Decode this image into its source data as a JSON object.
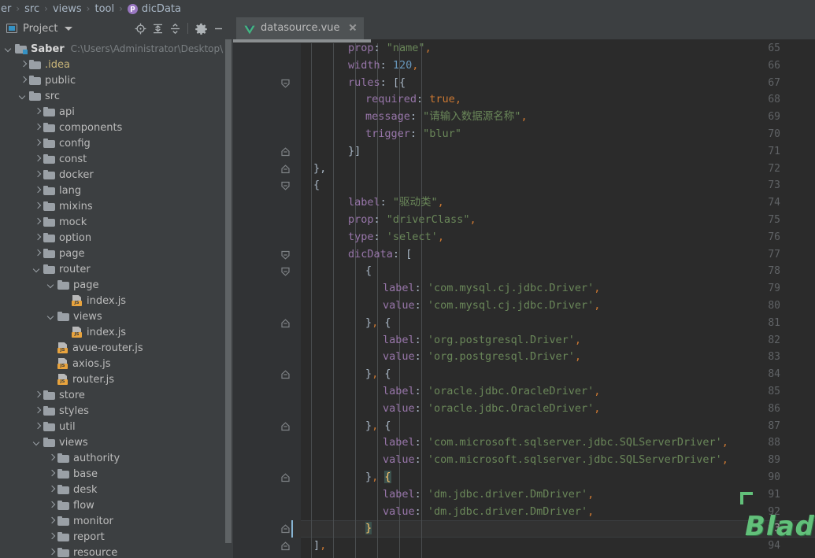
{
  "breadcrumb": {
    "items": [
      {
        "label": "er",
        "icon": null
      },
      {
        "label": "src",
        "icon": null
      },
      {
        "label": "views",
        "icon": null
      },
      {
        "label": "tool",
        "icon": null
      },
      {
        "label": "dicData",
        "icon": "property-icon"
      }
    ],
    "separator": "›",
    "property_icon_glyph": "p"
  },
  "sidebar": {
    "title": "Project",
    "icons": {
      "project": "project-panel-icon",
      "dropdown": "chevron-down-icon",
      "locate": "locate-icon",
      "expand_all": "expand-all-icon",
      "collapse_all": "collapse-all-icon",
      "settings": "gear-icon",
      "hide": "minimize-icon"
    },
    "tree": [
      {
        "label": "Saber",
        "hint": "C:\\Users\\Administrator\\Desktop\\IdeaP",
        "depth": 0,
        "type": "module",
        "state": "expanded",
        "bold": true
      },
      {
        "label": ".idea",
        "depth": 1,
        "type": "folder",
        "state": "collapsed",
        "tint": "yellow"
      },
      {
        "label": "public",
        "depth": 1,
        "type": "folder",
        "state": "collapsed"
      },
      {
        "label": "src",
        "depth": 1,
        "type": "folder",
        "state": "expanded"
      },
      {
        "label": "api",
        "depth": 2,
        "type": "folder",
        "state": "collapsed"
      },
      {
        "label": "components",
        "depth": 2,
        "type": "folder",
        "state": "collapsed"
      },
      {
        "label": "config",
        "depth": 2,
        "type": "folder",
        "state": "collapsed"
      },
      {
        "label": "const",
        "depth": 2,
        "type": "folder",
        "state": "collapsed"
      },
      {
        "label": "docker",
        "depth": 2,
        "type": "folder",
        "state": "collapsed"
      },
      {
        "label": "lang",
        "depth": 2,
        "type": "folder",
        "state": "collapsed"
      },
      {
        "label": "mixins",
        "depth": 2,
        "type": "folder",
        "state": "collapsed"
      },
      {
        "label": "mock",
        "depth": 2,
        "type": "folder",
        "state": "collapsed"
      },
      {
        "label": "option",
        "depth": 2,
        "type": "folder",
        "state": "collapsed"
      },
      {
        "label": "page",
        "depth": 2,
        "type": "folder",
        "state": "collapsed"
      },
      {
        "label": "router",
        "depth": 2,
        "type": "folder",
        "state": "expanded"
      },
      {
        "label": "page",
        "depth": 3,
        "type": "folder",
        "state": "expanded"
      },
      {
        "label": "index.js",
        "depth": 4,
        "type": "js"
      },
      {
        "label": "views",
        "depth": 3,
        "type": "folder",
        "state": "expanded"
      },
      {
        "label": "index.js",
        "depth": 4,
        "type": "js"
      },
      {
        "label": "avue-router.js",
        "depth": 3,
        "type": "js"
      },
      {
        "label": "axios.js",
        "depth": 3,
        "type": "js"
      },
      {
        "label": "router.js",
        "depth": 3,
        "type": "js"
      },
      {
        "label": "store",
        "depth": 2,
        "type": "folder",
        "state": "collapsed"
      },
      {
        "label": "styles",
        "depth": 2,
        "type": "folder",
        "state": "collapsed"
      },
      {
        "label": "util",
        "depth": 2,
        "type": "folder",
        "state": "collapsed"
      },
      {
        "label": "views",
        "depth": 2,
        "type": "folder",
        "state": "expanded"
      },
      {
        "label": "authority",
        "depth": 3,
        "type": "folder",
        "state": "collapsed"
      },
      {
        "label": "base",
        "depth": 3,
        "type": "folder",
        "state": "collapsed"
      },
      {
        "label": "desk",
        "depth": 3,
        "type": "folder",
        "state": "collapsed"
      },
      {
        "label": "flow",
        "depth": 3,
        "type": "folder",
        "state": "collapsed"
      },
      {
        "label": "monitor",
        "depth": 3,
        "type": "folder",
        "state": "collapsed"
      },
      {
        "label": "report",
        "depth": 3,
        "type": "folder",
        "state": "collapsed"
      },
      {
        "label": "resource",
        "depth": 3,
        "type": "folder",
        "state": "collapsed"
      }
    ]
  },
  "editor": {
    "tab": {
      "label": "datasource.vue",
      "icon": "vue-icon",
      "close_icon": "close-icon"
    },
    "current_line": 93,
    "first_line": 65,
    "lines": [
      {
        "n": 65,
        "indent": 0,
        "tokens": [
          {
            "t": "prop",
            "c": "prop"
          },
          {
            "t": ": ",
            "c": "pun"
          },
          {
            "t": "\"name\"",
            "c": "str"
          },
          {
            "t": ",",
            "c": "comma"
          }
        ]
      },
      {
        "n": 66,
        "indent": 0,
        "tokens": [
          {
            "t": "width",
            "c": "prop"
          },
          {
            "t": ": ",
            "c": "pun"
          },
          {
            "t": "120",
            "c": "num"
          },
          {
            "t": ",",
            "c": "comma"
          }
        ]
      },
      {
        "n": 67,
        "indent": 0,
        "fold": "start",
        "tokens": [
          {
            "t": "rules",
            "c": "prop"
          },
          {
            "t": ": [{",
            "c": "pun"
          }
        ]
      },
      {
        "n": 68,
        "indent": 1,
        "tokens": [
          {
            "t": "required",
            "c": "prop"
          },
          {
            "t": ": ",
            "c": "pun"
          },
          {
            "t": "true",
            "c": "kw"
          },
          {
            "t": ",",
            "c": "comma"
          }
        ]
      },
      {
        "n": 69,
        "indent": 1,
        "tokens": [
          {
            "t": "message",
            "c": "prop"
          },
          {
            "t": ": ",
            "c": "pun"
          },
          {
            "t": "\"请输入数据源名称\"",
            "c": "str"
          },
          {
            "t": ",",
            "c": "comma"
          }
        ]
      },
      {
        "n": 70,
        "indent": 1,
        "tokens": [
          {
            "t": "trigger",
            "c": "prop"
          },
          {
            "t": ": ",
            "c": "pun"
          },
          {
            "t": "\"blur\"",
            "c": "str"
          }
        ]
      },
      {
        "n": 71,
        "indent": 0,
        "fold": "end",
        "tokens": [
          {
            "t": "}]",
            "c": "pun"
          }
        ]
      },
      {
        "n": 72,
        "indent": -1,
        "fold": "end",
        "tokens": [
          {
            "t": "},",
            "c": "pun"
          }
        ]
      },
      {
        "n": 73,
        "indent": -1,
        "fold": "start",
        "tokens": [
          {
            "t": "{",
            "c": "pun"
          }
        ]
      },
      {
        "n": 74,
        "indent": 0,
        "tokens": [
          {
            "t": "label",
            "c": "prop"
          },
          {
            "t": ": ",
            "c": "pun"
          },
          {
            "t": "\"驱动类\"",
            "c": "str"
          },
          {
            "t": ",",
            "c": "comma"
          }
        ]
      },
      {
        "n": 75,
        "indent": 0,
        "tokens": [
          {
            "t": "prop",
            "c": "prop"
          },
          {
            "t": ": ",
            "c": "pun"
          },
          {
            "t": "\"driverClass\"",
            "c": "str"
          },
          {
            "t": ",",
            "c": "comma"
          }
        ]
      },
      {
        "n": 76,
        "indent": 0,
        "tokens": [
          {
            "t": "type",
            "c": "prop"
          },
          {
            "t": ": ",
            "c": "pun"
          },
          {
            "t": "'select'",
            "c": "str"
          },
          {
            "t": ",",
            "c": "comma"
          }
        ]
      },
      {
        "n": 77,
        "indent": 0,
        "fold": "start",
        "tokens": [
          {
            "t": "dicData",
            "c": "prop"
          },
          {
            "t": ": [",
            "c": "pun"
          }
        ]
      },
      {
        "n": 78,
        "indent": 1,
        "fold": "start",
        "tokens": [
          {
            "t": "{",
            "c": "pun"
          }
        ]
      },
      {
        "n": 79,
        "indent": 2,
        "tokens": [
          {
            "t": "label",
            "c": "prop"
          },
          {
            "t": ": ",
            "c": "pun"
          },
          {
            "t": "'com.mysql.cj.jdbc.Driver'",
            "c": "str"
          },
          {
            "t": ",",
            "c": "comma"
          }
        ]
      },
      {
        "n": 80,
        "indent": 2,
        "tokens": [
          {
            "t": "value",
            "c": "prop"
          },
          {
            "t": ": ",
            "c": "pun"
          },
          {
            "t": "'com.mysql.cj.jdbc.Driver'",
            "c": "str"
          },
          {
            "t": ",",
            "c": "comma"
          }
        ]
      },
      {
        "n": 81,
        "indent": 1,
        "fold": "end",
        "tokens": [
          {
            "t": "}",
            "c": "pun"
          },
          {
            "t": ",",
            "c": "comma"
          },
          {
            "t": " {",
            "c": "pun"
          }
        ]
      },
      {
        "n": 82,
        "indent": 2,
        "tokens": [
          {
            "t": "label",
            "c": "prop"
          },
          {
            "t": ": ",
            "c": "pun"
          },
          {
            "t": "'org.postgresql.Driver'",
            "c": "str"
          },
          {
            "t": ",",
            "c": "comma"
          }
        ]
      },
      {
        "n": 83,
        "indent": 2,
        "tokens": [
          {
            "t": "value",
            "c": "prop"
          },
          {
            "t": ": ",
            "c": "pun"
          },
          {
            "t": "'org.postgresql.Driver'",
            "c": "str"
          },
          {
            "t": ",",
            "c": "comma"
          }
        ]
      },
      {
        "n": 84,
        "indent": 1,
        "fold": "end",
        "tokens": [
          {
            "t": "}",
            "c": "pun"
          },
          {
            "t": ",",
            "c": "comma"
          },
          {
            "t": " {",
            "c": "pun"
          }
        ]
      },
      {
        "n": 85,
        "indent": 2,
        "tokens": [
          {
            "t": "label",
            "c": "prop"
          },
          {
            "t": ": ",
            "c": "pun"
          },
          {
            "t": "'oracle.jdbc.OracleDriver'",
            "c": "str"
          },
          {
            "t": ",",
            "c": "comma"
          }
        ]
      },
      {
        "n": 86,
        "indent": 2,
        "tokens": [
          {
            "t": "value",
            "c": "prop"
          },
          {
            "t": ": ",
            "c": "pun"
          },
          {
            "t": "'oracle.jdbc.OracleDriver'",
            "c": "str"
          },
          {
            "t": ",",
            "c": "comma"
          }
        ]
      },
      {
        "n": 87,
        "indent": 1,
        "fold": "end",
        "tokens": [
          {
            "t": "}",
            "c": "pun"
          },
          {
            "t": ",",
            "c": "comma"
          },
          {
            "t": " {",
            "c": "pun"
          }
        ]
      },
      {
        "n": 88,
        "indent": 2,
        "tokens": [
          {
            "t": "label",
            "c": "prop"
          },
          {
            "t": ": ",
            "c": "pun"
          },
          {
            "t": "'com.microsoft.sqlserver.jdbc.SQLServerDriver'",
            "c": "str"
          },
          {
            "t": ",",
            "c": "comma"
          }
        ]
      },
      {
        "n": 89,
        "indent": 2,
        "tokens": [
          {
            "t": "value",
            "c": "prop"
          },
          {
            "t": ": ",
            "c": "pun"
          },
          {
            "t": "'com.microsoft.sqlserver.jdbc.SQLServerDriver'",
            "c": "str"
          },
          {
            "t": ",",
            "c": "comma"
          }
        ]
      },
      {
        "n": 90,
        "indent": 1,
        "fold": "end",
        "tokens": [
          {
            "t": "}",
            "c": "pun"
          },
          {
            "t": ",",
            "c": "comma"
          },
          {
            "t": " ",
            "c": "pun"
          },
          {
            "t": "{",
            "c": "brace"
          }
        ]
      },
      {
        "n": 91,
        "indent": 2,
        "tokens": [
          {
            "t": "label",
            "c": "prop"
          },
          {
            "t": ": ",
            "c": "pun"
          },
          {
            "t": "'dm.jdbc.driver.DmDriver'",
            "c": "str"
          },
          {
            "t": ",",
            "c": "comma"
          }
        ]
      },
      {
        "n": 92,
        "indent": 2,
        "tokens": [
          {
            "t": "value",
            "c": "prop"
          },
          {
            "t": ": ",
            "c": "pun"
          },
          {
            "t": "'dm.jdbc.driver.DmDriver'",
            "c": "str"
          },
          {
            "t": ",",
            "c": "comma"
          }
        ]
      },
      {
        "n": 93,
        "indent": 1,
        "fold": "end",
        "current": true,
        "tokens": [
          {
            "t": "}",
            "c": "brace"
          }
        ]
      },
      {
        "n": 94,
        "indent": -1,
        "fold": "end",
        "tokens": [
          {
            "t": "]",
            "c": "pun"
          },
          {
            "t": ",",
            "c": "comma"
          }
        ]
      }
    ]
  },
  "watermark": {
    "text": "Blade技术社区",
    "color": "#62c07a"
  },
  "colors": {
    "bg_editor": "#2b2b2b",
    "bg_panel": "#3c3f41",
    "gutter": "#313335",
    "text": "#a9b7c6",
    "property": "#9876aa",
    "string": "#6a8759",
    "number": "#6897bb",
    "keyword": "#cc7832",
    "accent": "#3592c4"
  }
}
